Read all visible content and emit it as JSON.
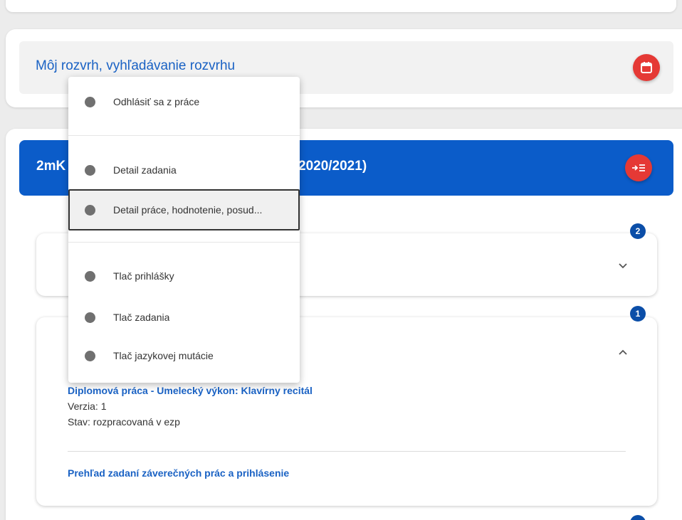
{
  "schedule": {
    "link_text": "Môj rozvrh, vyhľadávanie rozvrhu",
    "icon": "calendar-icon",
    "button_color": "#e53935"
  },
  "study": {
    "title_prefix": "2mK",
    "title_suffix": "2020/2021)",
    "icon": "login-list-icon",
    "bar_color": "#0b5cc9"
  },
  "section1": {
    "badge": "2",
    "icon": "chevron-down-icon"
  },
  "section2": {
    "badge": "1",
    "icon": "chevron-up-icon",
    "thesis_title": "Diplomová práca - Umelecký výkon: Klavírny recitál",
    "version": "Verzia: 1",
    "status": "Stav: rozpracovaná v ezp",
    "overview_link": "Prehľad zadaní záverečných prác a prihlásenie"
  },
  "context_menu": {
    "items": [
      {
        "label": "Odhlásiť sa z práce"
      },
      {
        "label": "Detail zadania"
      },
      {
        "label": "Detail práce, hodnotenie, posud..."
      },
      {
        "label": "Tlač prihlášky"
      },
      {
        "label": "Tlač zadania"
      },
      {
        "label": "Tlač jazykovej mutácie"
      }
    ],
    "selected_index": 2
  }
}
